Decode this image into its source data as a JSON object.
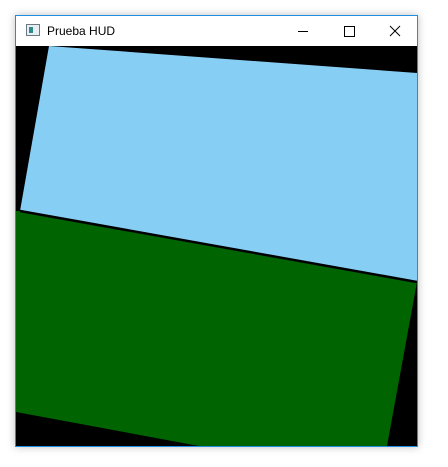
{
  "window": {
    "title": "Prueba HUD",
    "icon": "app-window-icon",
    "buttons": {
      "minimize": "minimize-icon",
      "maximize": "maximize-icon",
      "close": "close-icon"
    }
  },
  "scene": {
    "background_color": "#000000",
    "sky_color": "#87CEF5",
    "ground_color": "#006400",
    "horizon_line_color": "#000000"
  }
}
